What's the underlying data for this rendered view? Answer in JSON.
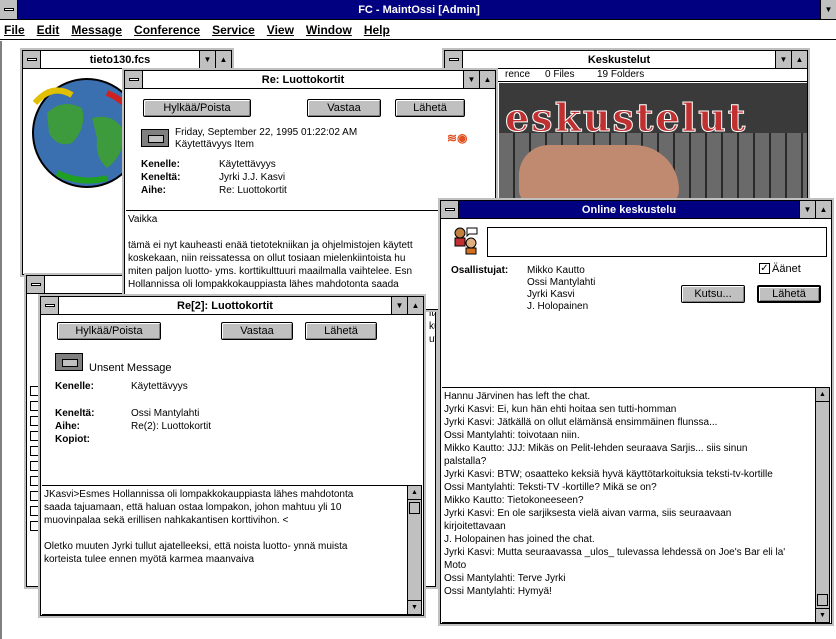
{
  "app": {
    "title": "FC - MaintOssi [Admin]",
    "menu": [
      "File",
      "Edit",
      "Message",
      "Conference",
      "Service",
      "View",
      "Window",
      "Help"
    ]
  },
  "tieto": {
    "title": "tieto130.fcs"
  },
  "keskustelut": {
    "title": "Keskustelut",
    "info_conference": "rence",
    "info_files": "0 Files",
    "info_folders": "19 Folders",
    "banner_text": "eskustelut"
  },
  "re1": {
    "title": "Re: Luottokortit",
    "btn_reject": "Hylkää/Poista",
    "btn_reply": "Vastaa",
    "btn_send": "Lähetä",
    "date": "Friday, September 22, 1995 01:22:02 AM",
    "item_type": "Käytettävyys Item",
    "to_label": "Kenelle:",
    "to_value": "Käytettävyys",
    "from_label": "Keneltä:",
    "from_value": "Jyrki J.J. Kasvi",
    "subject_label": "Aihe:",
    "subject_value": "Re: Luottokortit",
    "body": [
      "Vaikka",
      "",
      "tämä ei nyt kauheasti enää tietotekniikan ja ohjelmistojen käytett",
      "koskekaan, niin reissatessa on ollut tosiaan mielenkiintoista hu",
      "miten paljon luotto- yms. korttikulttuuri maailmalla vaihtelee. Esn",
      "Hollannissa oli lompakkokauppiasta lähes mahdotonta saada"
    ]
  },
  "re2": {
    "title": "Re[2]: Luottokortit",
    "btn_reject": "Hylkää/Poista",
    "btn_reply": "Vastaa",
    "btn_send": "Lähetä",
    "status": "Unsent Message",
    "to_label": "Kenelle:",
    "to_value": "Käytettävyys",
    "from_label": "Keneltä:",
    "from_value": "Ossi Mantylahti",
    "subject_label": "Aihe:",
    "subject_value": "Re(2): Luottokortit",
    "cc_label": "Kopiot:",
    "body": [
      "JKasvi>Esmes Hollannissa oli lompakkokauppiasta lähes mahdotonta",
      "saada tajuamaan, että haluan ostaa lompakon, johon mahtuu yli 10",
      "muovinpalaa sekä erillisen nahkakantisen korttivihon. <",
      "",
      "Oletko muuten Jyrki tullut ajatelleeksi, että noista luotto- ynnä muista",
      "korteista tulee ennen myötä karmea maanvaiva"
    ]
  },
  "behind_fragments": [
    "ita",
    "ku",
    "ut"
  ],
  "online": {
    "title": "Online keskustelu",
    "participants_label": "Osallistujat:",
    "participants": [
      "Mikko Kautto",
      "Ossi Mantylahti",
      "Jyrki Kasvi",
      "J. Holopainen"
    ],
    "sounds_label": "Äänet",
    "btn_invite": "Kutsu...",
    "btn_send": "Lähetä",
    "chat": [
      "Hannu Järvinen has left the chat.",
      "Jyrki Kasvi: Ei, kun hän ehti hoitaa sen tutti-homman",
      "Jyrki Kasvi: Jätkällä on ollut elämänsä ensimmäinen flunssa...",
      "Ossi Mantylahti: toivotaan niin.",
      "Mikko Kautto: JJJ: Mikäs on Pelit-lehden seuraava Sarjis... siis sinun",
      "palstalla?",
      "Jyrki Kasvi: BTW; osaatteko keksiä hyvä käyttötarkoituksia teksti-tv-kortille",
      "Ossi Mantylahti: Teksti-TV -kortille? Mikä se on?",
      "Mikko Kautto: Tietokoneeseen?",
      "Jyrki Kasvi: En ole sarjiksesta vielä aivan varma, siis seuraavaan",
      "kirjoitettavaan",
      "J. Holopainen has joined the chat.",
      "Jyrki Kasvi: Mutta seuraavassa _ulos_ tulevassa lehdessä on Joe's Bar eli la'",
      "Moto",
      "Ossi Mantylahti: Terve Jyrki",
      "Ossi Mantylahti: Hymyä!"
    ]
  },
  "colors": {
    "active_title": "#000080",
    "chrome": "#c0c0c0",
    "desktop": "#ffffff"
  }
}
